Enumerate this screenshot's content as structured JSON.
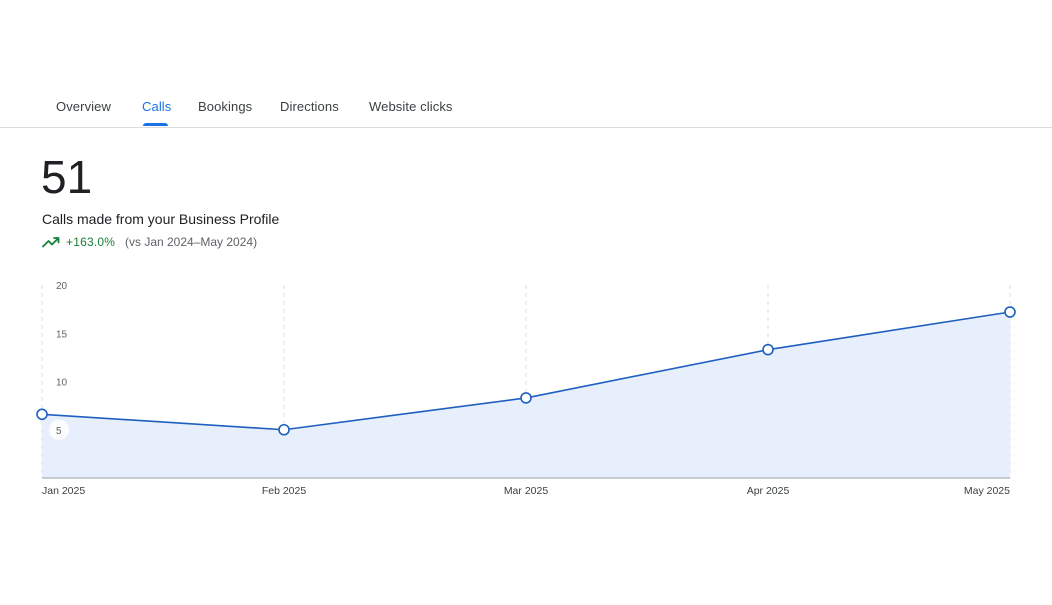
{
  "tabs": [
    {
      "label": "Overview",
      "active": false
    },
    {
      "label": "Calls",
      "active": true
    },
    {
      "label": "Bookings",
      "active": false
    },
    {
      "label": "Directions",
      "active": false
    },
    {
      "label": "Website clicks",
      "active": false
    }
  ],
  "summary": {
    "total": "51",
    "description": "Calls made from your Business Profile",
    "change": "+163.0%",
    "comparison": "(vs Jan 2024–May 2024)",
    "trend_icon": "trending-up-icon"
  },
  "colors": {
    "accent": "#1a73e8",
    "line": "#1f5fbf",
    "area": "#e8effc",
    "positive": "#188038"
  },
  "chart_data": {
    "type": "area",
    "categories": [
      "Jan 2025",
      "Feb 2025",
      "Mar 2025",
      "Apr 2025",
      "May 2025"
    ],
    "series": [
      {
        "values": [
          6.6,
          5,
          8.3,
          13.3,
          17.2
        ]
      }
    ],
    "y_ticks": [
      5,
      10,
      15,
      20
    ],
    "ylim": [
      0,
      20
    ],
    "grid": "vertical dashed",
    "legend": "none"
  }
}
